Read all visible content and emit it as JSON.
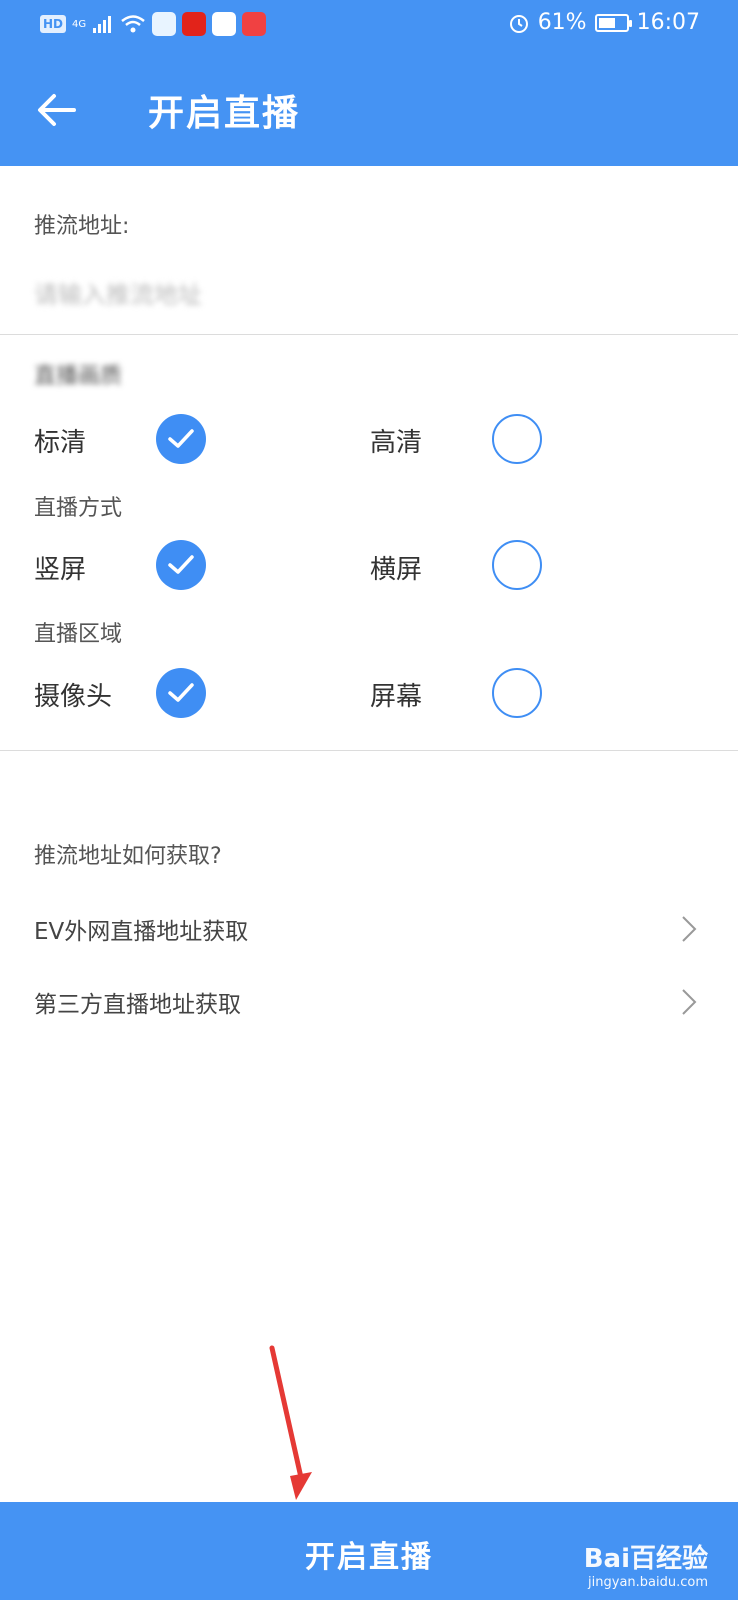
{
  "status_bar": {
    "left_badge": "HD",
    "network": "4G",
    "battery_text": "61%",
    "battery_level": 0.61,
    "time": "16:07"
  },
  "header": {
    "title": "开启直播"
  },
  "push": {
    "label": "推流地址:",
    "input_value": "请输入推流地址"
  },
  "sections": {
    "quality": {
      "label": "直播画质",
      "options": [
        {
          "label": "标清",
          "selected": true
        },
        {
          "label": "高清",
          "selected": false
        }
      ]
    },
    "mode": {
      "label": "直播方式",
      "options": [
        {
          "label": "竖屏",
          "selected": true
        },
        {
          "label": "横屏",
          "selected": false
        }
      ]
    },
    "area": {
      "label": "直播区域",
      "options": [
        {
          "label": "摄像头",
          "selected": true
        },
        {
          "label": "屏幕",
          "selected": false
        }
      ]
    }
  },
  "help": {
    "title": "推流地址如何获取?",
    "links": [
      "EV外网直播地址获取",
      "第三方直播地址获取"
    ]
  },
  "bottom_button": {
    "label": "开启直播"
  },
  "watermark": {
    "text": "Bai百经验",
    "sub": "jingyan.baidu.com"
  },
  "colors": {
    "primary": "#4593f3",
    "check": "#3f8ef4",
    "annotation_arrow": "#e53935"
  }
}
